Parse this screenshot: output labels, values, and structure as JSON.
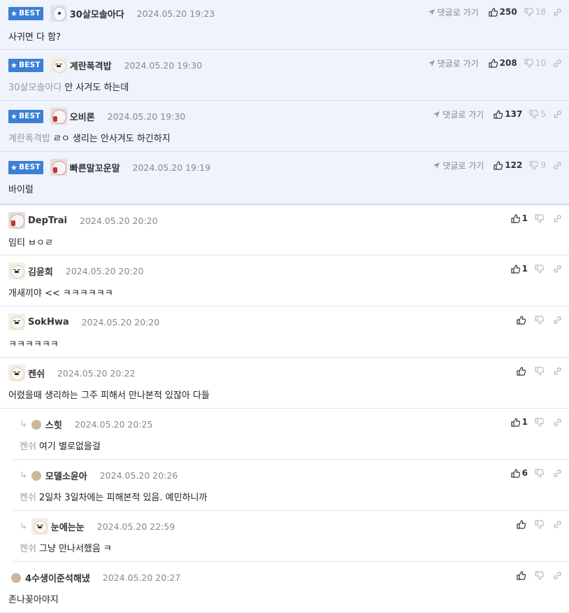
{
  "best_badge": "BEST",
  "goto_label": "댓글로 가기",
  "best_comments": [
    {
      "nick": "30살모솔아다",
      "date": "2024.05.20 19:23",
      "text": "사귀면 다 함?",
      "mention": "",
      "up": "250",
      "down": "18",
      "avatar": "bear"
    },
    {
      "nick": "계란폭격밥",
      "date": "2024.05.20 19:30",
      "text": "안 사겨도 하는데",
      "mention": "30살모솔아다",
      "up": "208",
      "down": "10",
      "avatar": "dog"
    },
    {
      "nick": "오비론",
      "date": "2024.05.20 19:30",
      "text": "ㄹㅇ 생리는 안사겨도 하긴하지",
      "mention": "계란폭격밥",
      "up": "137",
      "down": "5",
      "avatar": "redbear"
    },
    {
      "nick": "빠른말꼬운말",
      "date": "2024.05.20 19:19",
      "text": "바이럴",
      "mention": "",
      "up": "122",
      "down": "9",
      "avatar": "redbear"
    }
  ],
  "comments": [
    {
      "nick": "DepTrai",
      "date": "2024.05.20 20:20",
      "text": "임티 ㅂㅇㄹ",
      "mention": "",
      "up": "1",
      "avatar": "redbear",
      "reply": false
    },
    {
      "nick": "김윤희",
      "date": "2024.05.20 20:20",
      "text": "개새끼야 << ㅋㅋㅋㅋㅋㅋ",
      "mention": "",
      "up": "1",
      "avatar": "dog",
      "reply": false
    },
    {
      "nick": "SokHwa",
      "date": "2024.05.20 20:20",
      "text": "ㅋㅋㅋㅋㅋㅋ",
      "mention": "",
      "up": "",
      "avatar": "dog",
      "reply": false
    },
    {
      "nick": "켄쉬",
      "date": "2024.05.20 20:22",
      "text": "어렸을때 생리하는 그주 피해서 만나본적 있잖아 다들",
      "mention": "",
      "up": "",
      "avatar": "dog",
      "reply": false
    },
    {
      "nick": "스힛",
      "date": "2024.05.20 20:25",
      "text": "여기 별로없을걸",
      "mention": "켄쉬",
      "up": "1",
      "avatar": "dot",
      "reply": true
    },
    {
      "nick": "모델소윤아",
      "date": "2024.05.20 20:26",
      "text": "2일차 3일차에는 피해본적 있음. 예민하니까",
      "mention": "켄쉬",
      "up": "6",
      "avatar": "dot",
      "reply": true
    },
    {
      "nick": "눈에는눈",
      "date": "2024.05.20 22:59",
      "text": "그냥 만나서했음 ㅋ",
      "mention": "켄쉬",
      "up": "",
      "avatar": "dog",
      "reply": true
    },
    {
      "nick": "4수생이준석해냈",
      "date": "2024.05.20 20:27",
      "text": "존나꽂아야지",
      "mention": "",
      "up": "",
      "avatar": "dot",
      "reply": false
    }
  ]
}
